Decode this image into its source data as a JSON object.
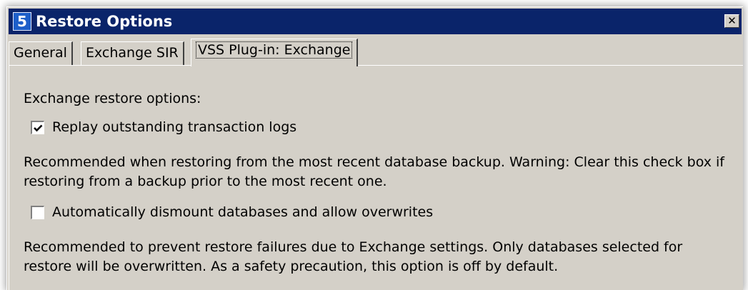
{
  "window": {
    "title": "Restore Options",
    "app_icon": "5",
    "close_glyph": "✕"
  },
  "tabs": [
    {
      "label": "General",
      "active": false
    },
    {
      "label": "Exchange SIR",
      "active": false
    },
    {
      "label": "VSS Plug-in: Exchange",
      "active": true
    }
  ],
  "panel": {
    "section_heading": "Exchange restore options:",
    "option_replay": {
      "label": "Replay outstanding transaction logs",
      "checked": true,
      "description_line1": "Recommended when restoring from the most recent database backup. Warning: Clear this check box if",
      "description_line2": "restoring from a backup prior to the most recent one."
    },
    "option_dismount": {
      "label": "Automatically dismount databases and allow overwrites",
      "checked": false,
      "description_line1": "Recommended to prevent restore failures due to Exchange settings. Only databases selected for",
      "description_line2": "restore will be overwritten. As a safety precaution, this option is off by default."
    }
  },
  "colors": {
    "titlebar": "#0a246a",
    "dialog_face": "#d4d0c8"
  }
}
